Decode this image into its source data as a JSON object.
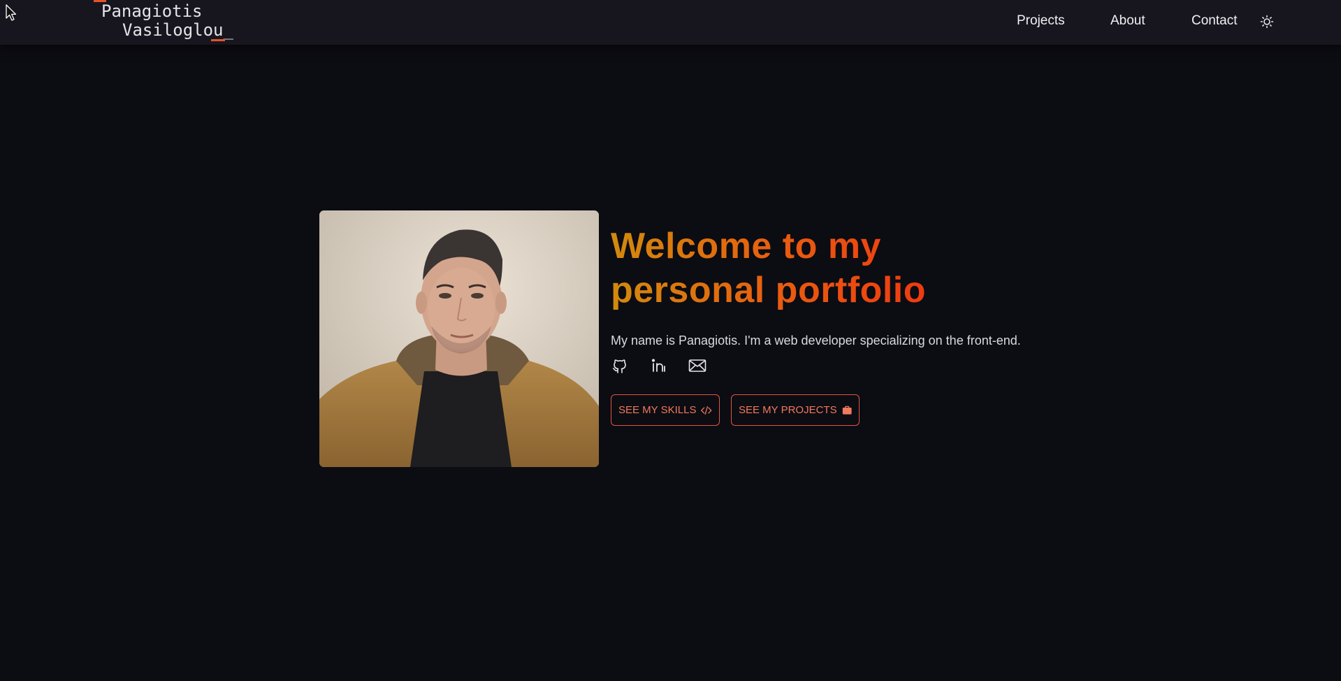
{
  "header": {
    "logo_line1": "Panagiotis",
    "logo_line2": "Vasiloglou_",
    "nav": {
      "projects": "Projects",
      "about": "About",
      "contact": "Contact"
    },
    "theme_toggle_icon": "sun-icon"
  },
  "hero": {
    "photo_icon": "profile-photo",
    "title": "Welcome to my personal portfolio",
    "subtitle": "My name is Panagiotis. I'm a web developer specializing on the front-end.",
    "socials": [
      "github-icon",
      "linkedin-icon",
      "mail-icon"
    ],
    "buttons": {
      "skills": "SEE MY SKILLS",
      "skills_icon": "code-icon",
      "projects": "SEE MY PROJECTS",
      "projects_icon": "briefcase-icon"
    }
  },
  "colors": {
    "background": "#0c0c13",
    "header_bg": "#17161f",
    "accent": "#e5532b",
    "title_gradient_start": "#d28a0d",
    "title_gradient_end": "#ef3710",
    "button_border": "#e0573f"
  }
}
